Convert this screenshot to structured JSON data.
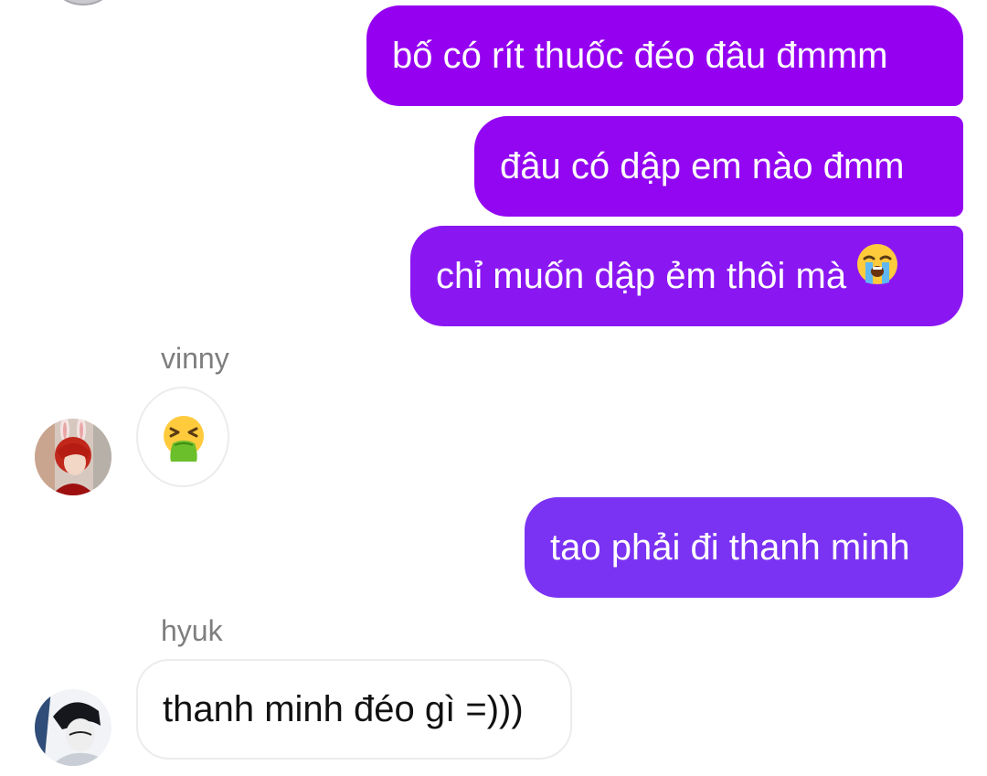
{
  "messages": {
    "outgoing_1": "bố có rít thuốc đéo đâu đmmm",
    "outgoing_2": "đâu có dập em nào đmm",
    "outgoing_3": "chỉ muốn dập ẻm thôi mà",
    "outgoing_3_emoji": "loudly-crying-face-icon",
    "outgoing_4": "tao phải đi thanh minh"
  },
  "senders": {
    "vinny": "vinny",
    "hyuk": "hyuk"
  },
  "incoming": {
    "vinny_reaction_emoji": "vomiting-face-icon",
    "hyuk_message": "thanh minh đéo gì =)))"
  },
  "colors": {
    "outgoing_top": "#9500f1",
    "outgoing_bottom": "#7b33f3",
    "incoming_border": "#ececec",
    "sender_name": "#7e7e7e"
  }
}
